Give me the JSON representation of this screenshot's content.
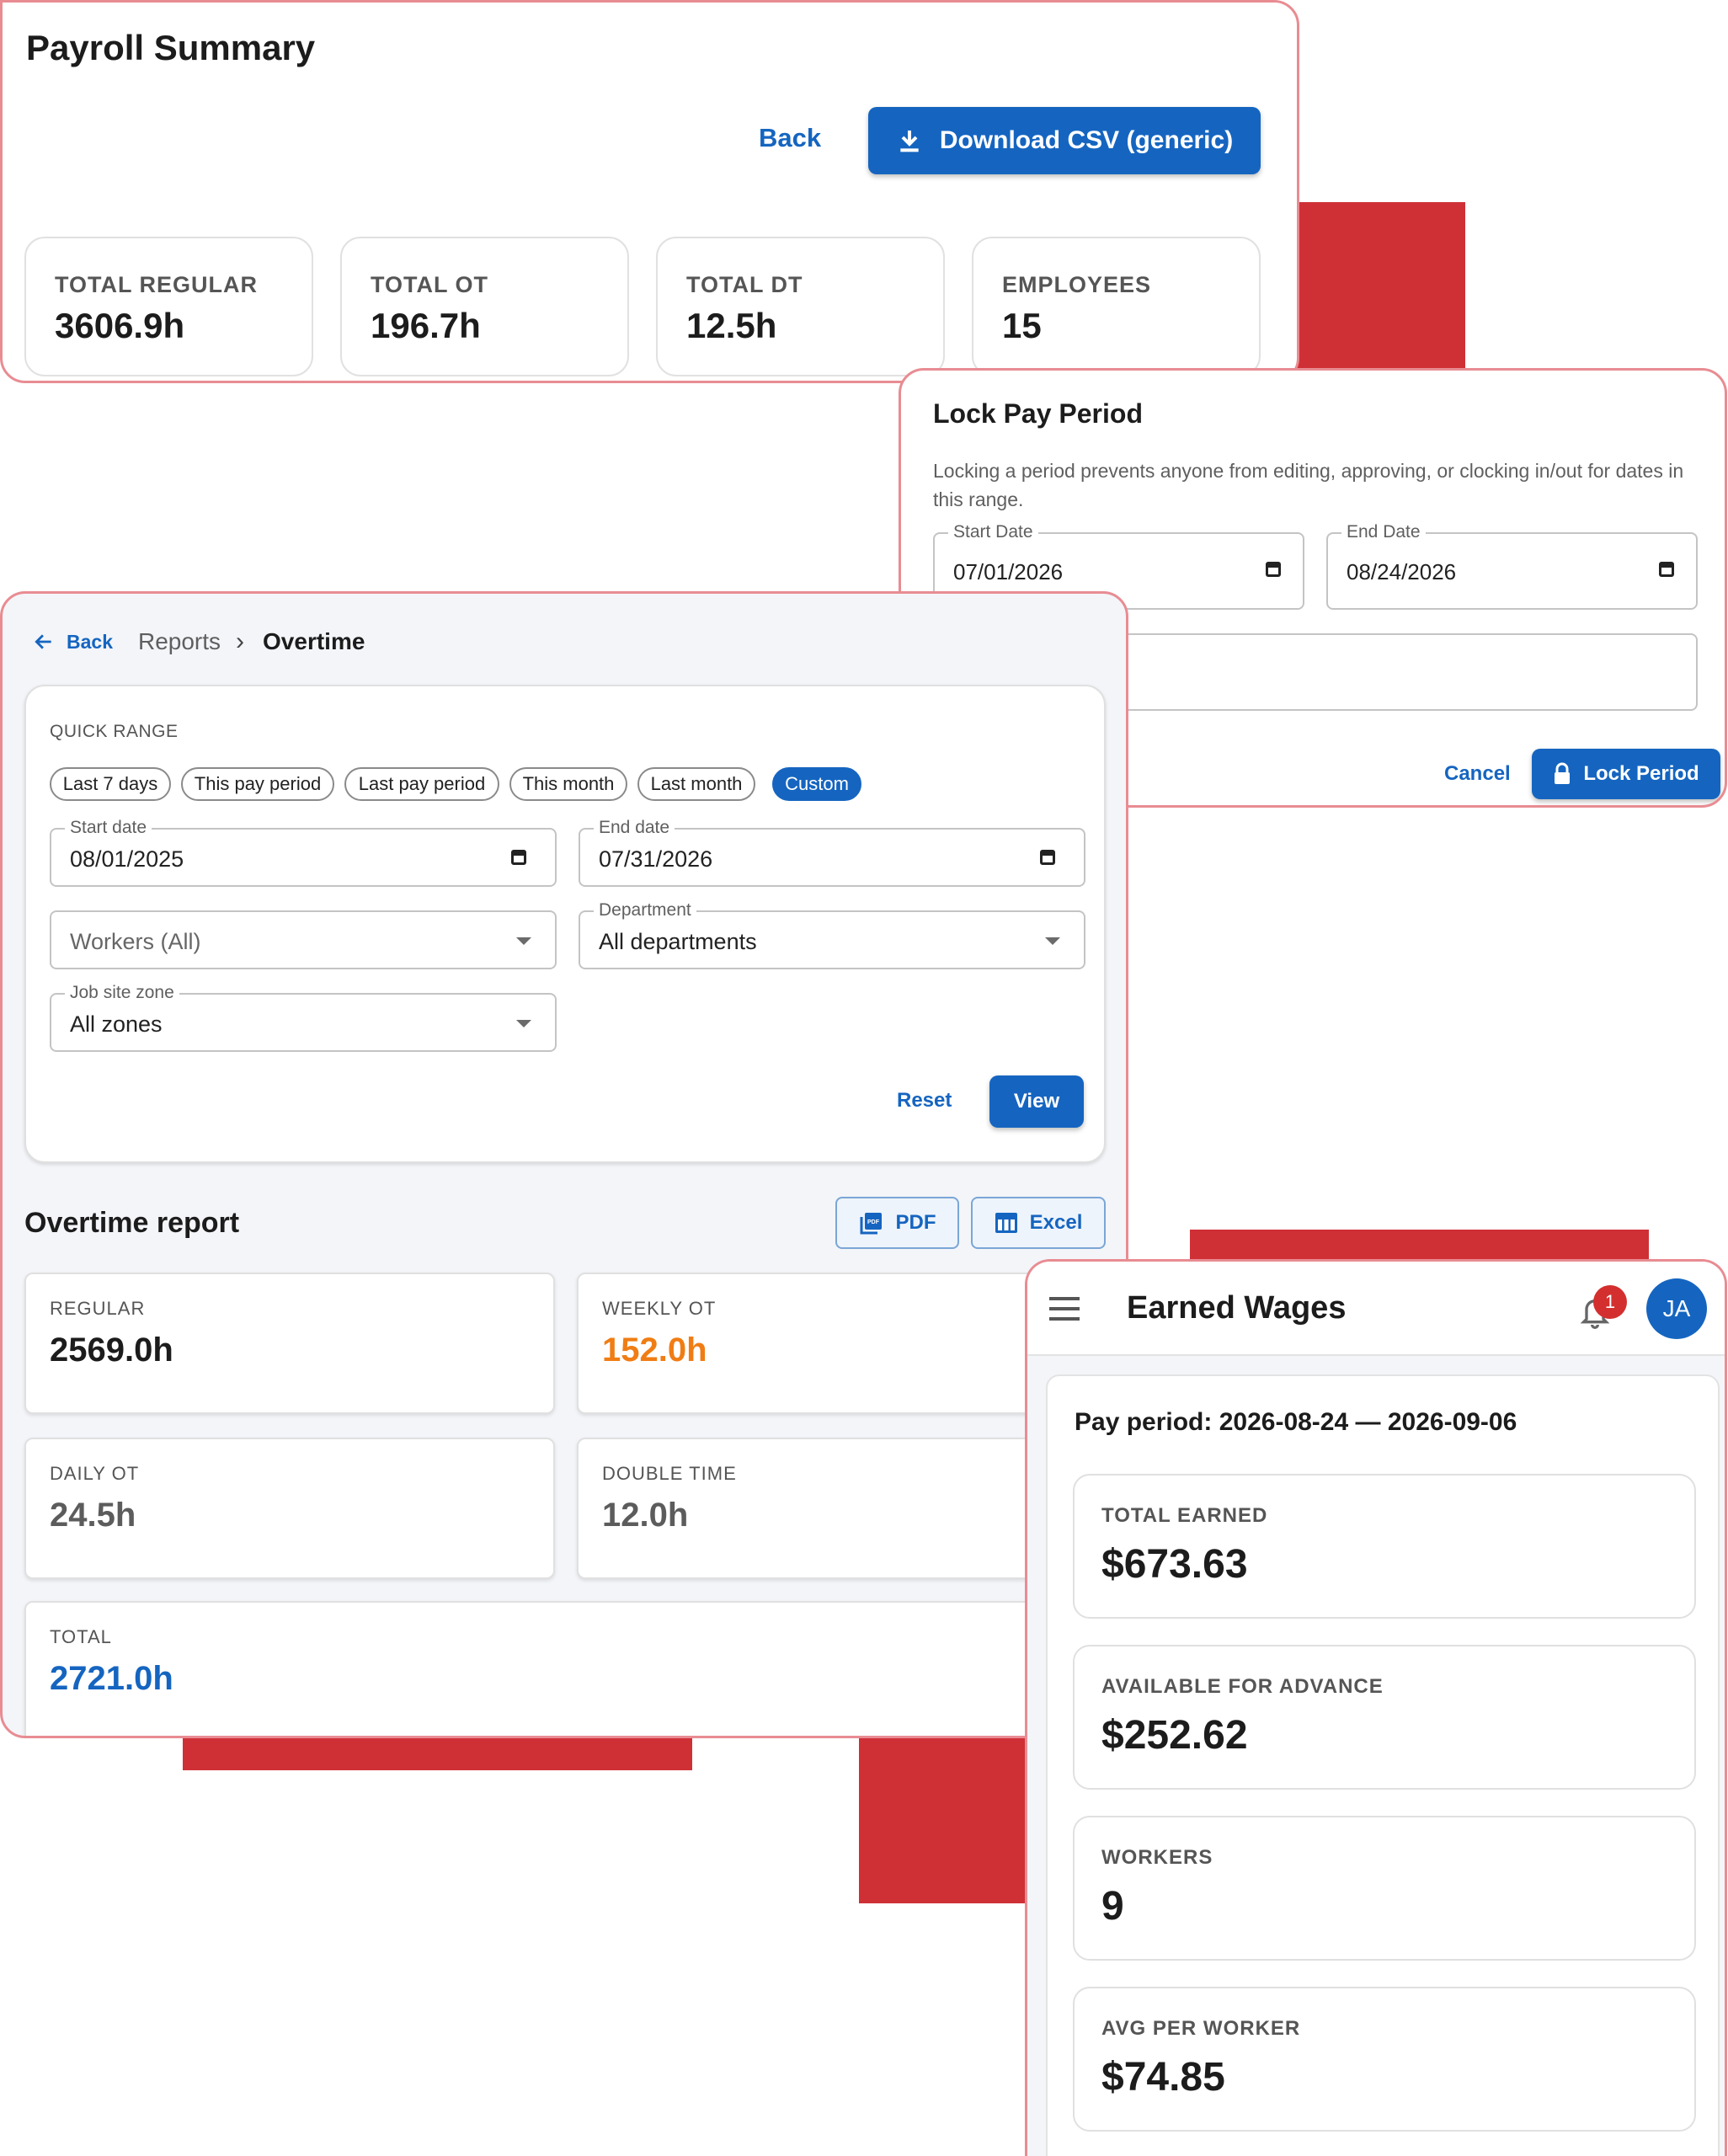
{
  "payroll": {
    "title": "Payroll Summary",
    "back_label": "Back",
    "download_label": "Download CSV (generic)",
    "stats": [
      {
        "label": "TOTAL REGULAR",
        "value": "3606.9h"
      },
      {
        "label": "TOTAL OT",
        "value": "196.7h"
      },
      {
        "label": "TOTAL DT",
        "value": "12.5h"
      },
      {
        "label": "EMPLOYEES",
        "value": "15"
      }
    ]
  },
  "lock": {
    "title": "Lock Pay Period",
    "description": "Locking a period prevents anyone from editing, approving, or clocking in/out for dates in this range.",
    "start_label": "Start Date",
    "start_value": "07/01/2026",
    "end_label": "End Date",
    "end_value": "08/24/2026",
    "cancel_label": "Cancel",
    "lock_label": "Lock Period"
  },
  "overtime": {
    "back_label": "Back",
    "breadcrumb_reports": "Reports",
    "breadcrumb_current": "Overtime",
    "quick_range_label": "QUICK RANGE",
    "chips": [
      "Last 7 days",
      "This pay period",
      "Last pay period",
      "This month",
      "Last month",
      "Custom"
    ],
    "active_chip": "Custom",
    "start_label": "Start date",
    "start_value": "08/01/2025",
    "end_label": "End date",
    "end_value": "07/31/2026",
    "workers_placeholder": "Workers (All)",
    "department_label": "Department",
    "department_value": "All departments",
    "zone_label": "Job site zone",
    "zone_value": "All zones",
    "reset_label": "Reset",
    "view_label": "View",
    "report_title": "Overtime report",
    "pdf_label": "PDF",
    "excel_label": "Excel",
    "stats": [
      {
        "label": "REGULAR",
        "value": "2569.0h",
        "color": "#1c1c1c"
      },
      {
        "label": "WEEKLY OT",
        "value": "152.0h",
        "color": "#f07d14"
      },
      {
        "label": "DAILY OT",
        "value": "24.5h",
        "color": "#5c5c5c"
      },
      {
        "label": "DOUBLE TIME",
        "value": "12.0h",
        "color": "#5c5c5c"
      },
      {
        "label": "TOTAL",
        "value": "2721.0h",
        "color": "#1565c0"
      }
    ]
  },
  "wages": {
    "title": "Earned Wages",
    "notification_count": "1",
    "avatar_initials": "JA",
    "period": "Pay period: 2026-08-24 — 2026-09-06",
    "stats": [
      {
        "label": "TOTAL EARNED",
        "value": "$673.63"
      },
      {
        "label": "AVAILABLE FOR ADVANCE",
        "value": "$252.62"
      },
      {
        "label": "WORKERS",
        "value": "9"
      },
      {
        "label": "AVG PER WORKER",
        "value": "$74.85"
      }
    ]
  },
  "colors": {
    "accent": "#1565c0",
    "decor_red": "#cf3036",
    "panel_border": "#e88c92",
    "weekly_ot": "#f07d14"
  }
}
